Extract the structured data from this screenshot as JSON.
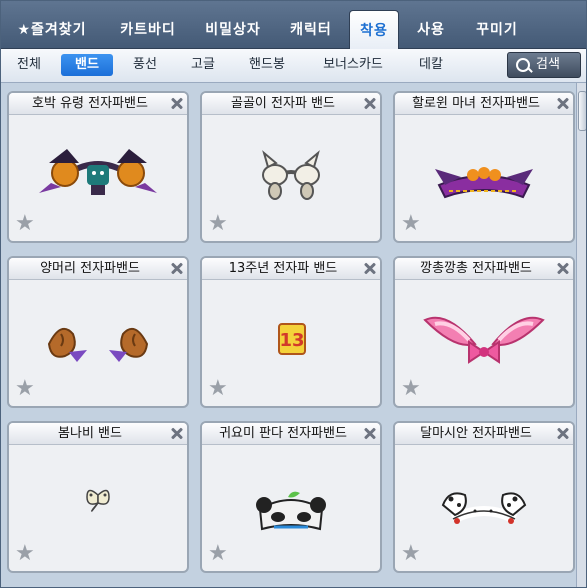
{
  "tabs": [
    {
      "label": "★즐겨찾기",
      "active": false
    },
    {
      "label": "카트바디",
      "active": false
    },
    {
      "label": "비밀상자",
      "active": false
    },
    {
      "label": "캐릭터",
      "active": false
    },
    {
      "label": "착용",
      "active": true
    },
    {
      "label": "사용",
      "active": false
    },
    {
      "label": "꾸미기",
      "active": false
    }
  ],
  "subtabs": [
    {
      "label": "전체",
      "active": false
    },
    {
      "label": "밴드",
      "active": true
    },
    {
      "label": "풍선",
      "active": false
    },
    {
      "label": "고글",
      "active": false
    },
    {
      "label": "핸드봉",
      "active": false
    },
    {
      "label": "보너스카드",
      "active": false
    },
    {
      "label": "데칼",
      "active": false
    }
  ],
  "search": {
    "label": "검색"
  },
  "items": [
    {
      "name": "호박 유령 전자파밴드",
      "icon": "pumpkin-ghost-band-icon"
    },
    {
      "name": "골골이 전자파 밴드",
      "icon": "cat-paw-band-icon"
    },
    {
      "name": "할로윈 마녀 전자파밴드",
      "icon": "witch-hat-band-icon"
    },
    {
      "name": "양머리 전자파밴드",
      "icon": "sheep-head-band-icon"
    },
    {
      "name": "13주년 전자파 밴드",
      "icon": "13th-anniversary-band-icon"
    },
    {
      "name": "깡총깡총 전자파밴드",
      "icon": "bunny-ear-band-icon"
    },
    {
      "name": "봄나비 밴드",
      "icon": "butterfly-band-icon"
    },
    {
      "name": "귀요미 판다 전자파밴드",
      "icon": "panda-band-icon"
    },
    {
      "name": "달마시안 전자파밴드",
      "icon": "dalmatian-band-icon"
    }
  ],
  "colors": {
    "accent": "#1c6fd1",
    "header_bg": "#445a76",
    "card_bg": "#eef0f3"
  }
}
